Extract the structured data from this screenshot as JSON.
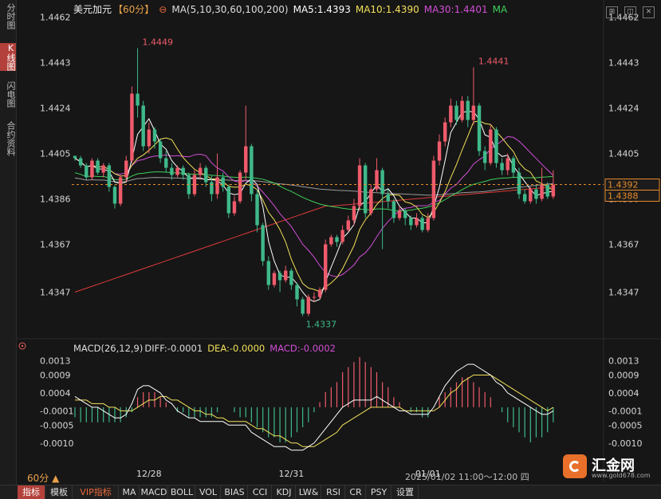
{
  "sidebar": {
    "tabs": [
      {
        "label": "分时图",
        "active": false
      },
      {
        "label": "K线图",
        "active": true
      },
      {
        "label": "闪电图",
        "active": false
      },
      {
        "label": "合约资料",
        "active": false
      }
    ]
  },
  "header": {
    "symbol": "美元加元",
    "period": "【60分】",
    "ma_params": "MA(5,10,30,60,100,200)",
    "ma5": "MA5:1.4393",
    "ma10": "MA10:1.4390",
    "ma30": "MA30:1.4401",
    "ma": "MA"
  },
  "macd_header": {
    "title": "MACD(26,12,9)",
    "diff": "DIFF:-0.0001",
    "dea": "DEA:-0.0000",
    "macd": "MACD:-0.0002"
  },
  "period_label": "60分 ▲",
  "time_range": "2025/01/02 11:00～12:00 四",
  "toolbar": [
    "指标",
    "模板",
    "VIP指标",
    "MA",
    "MACD",
    "BOLL",
    "VOL",
    "BIAS",
    "CCI",
    "KDJ",
    "LW&",
    "RSI",
    "CR",
    "PSY",
    "设置"
  ],
  "brand": {
    "name": "汇金网",
    "url": "www.gold678.com"
  },
  "colors": {
    "up": "#ef5b6b",
    "down": "#3fb98a",
    "ma5": "#ffffff",
    "ma10": "#f3e15b",
    "ma30": "#d14fd6",
    "ma60": "#3fd05a",
    "ma100": "#9a9a9a",
    "ma200": "#e03a3a",
    "dea": "#f3e15b",
    "diff": "#ffffff",
    "current": "#e88a2a"
  },
  "chart_data": [
    {
      "type": "candlestick",
      "title": "美元加元 60分",
      "ylim": [
        1.4335,
        1.4465
      ],
      "y_ticks": [
        "1.4462",
        "1.4443",
        "1.4424",
        "1.4405",
        "1.4386",
        "1.4367",
        "1.4347"
      ],
      "x_labels": [
        "12/28",
        "12/31",
        "01/01"
      ],
      "annotations": {
        "high_1": "1.4449",
        "high_2": "1.4441",
        "low": "1.4337",
        "last_price": "1.4392",
        "marker_price": "1.4388"
      },
      "candles": [
        [
          1.4404,
          1.4403,
          1.4404,
          1.4402
        ],
        [
          1.4403,
          1.44,
          1.4404,
          1.4399
        ],
        [
          1.44,
          1.4395,
          1.4401,
          1.4394
        ],
        [
          1.4395,
          1.4402,
          1.4403,
          1.4394
        ],
        [
          1.4402,
          1.4397,
          1.4403,
          1.4396
        ],
        [
          1.4397,
          1.44,
          1.4401,
          1.4395
        ],
        [
          1.44,
          1.4391,
          1.4401,
          1.4389
        ],
        [
          1.4391,
          1.4384,
          1.4392,
          1.4382
        ],
        [
          1.4384,
          1.4395,
          1.4396,
          1.4383
        ],
        [
          1.4395,
          1.4402,
          1.4404,
          1.4393
        ],
        [
          1.4402,
          1.443,
          1.4433,
          1.4401
        ],
        [
          1.443,
          1.4425,
          1.4449,
          1.442
        ],
        [
          1.4425,
          1.4408,
          1.4427,
          1.4406
        ],
        [
          1.4408,
          1.4415,
          1.4418,
          1.4405
        ],
        [
          1.4415,
          1.441,
          1.4416,
          1.4407
        ],
        [
          1.441,
          1.4403,
          1.4411,
          1.4401
        ],
        [
          1.4403,
          1.4399,
          1.4406,
          1.4397
        ],
        [
          1.4399,
          1.4396,
          1.4401,
          1.4394
        ],
        [
          1.4396,
          1.4399,
          1.44,
          1.4395
        ],
        [
          1.4399,
          1.4396,
          1.44,
          1.4394
        ],
        [
          1.4396,
          1.4388,
          1.4397,
          1.4386
        ],
        [
          1.4388,
          1.4396,
          1.4398,
          1.4387
        ],
        [
          1.4396,
          1.4399,
          1.4401,
          1.4394
        ],
        [
          1.4399,
          1.4393,
          1.44,
          1.4391
        ],
        [
          1.4393,
          1.4388,
          1.4396,
          1.4385
        ],
        [
          1.4388,
          1.4395,
          1.4405,
          1.4386
        ],
        [
          1.4395,
          1.4391,
          1.4397,
          1.4389
        ],
        [
          1.4391,
          1.438,
          1.4392,
          1.4378
        ],
        [
          1.438,
          1.4385,
          1.4387,
          1.4379
        ],
        [
          1.4385,
          1.4397,
          1.4398,
          1.4384
        ],
        [
          1.4397,
          1.4408,
          1.4425,
          1.4394
        ],
        [
          1.4408,
          1.4388,
          1.4409,
          1.4385
        ],
        [
          1.4388,
          1.4375,
          1.439,
          1.4372
        ],
        [
          1.4375,
          1.436,
          1.4376,
          1.4358
        ],
        [
          1.436,
          1.435,
          1.4362,
          1.4348
        ],
        [
          1.435,
          1.4355,
          1.4356,
          1.4349
        ],
        [
          1.4355,
          1.4352,
          1.4356,
          1.4347
        ],
        [
          1.4352,
          1.4356,
          1.4358,
          1.4351
        ],
        [
          1.4356,
          1.435,
          1.4357,
          1.4348
        ],
        [
          1.435,
          1.4344,
          1.4351,
          1.4341
        ],
        [
          1.4344,
          1.4338,
          1.4345,
          1.4337
        ],
        [
          1.4338,
          1.4345,
          1.4346,
          1.4337
        ],
        [
          1.4345,
          1.4345,
          1.4347,
          1.4343
        ],
        [
          1.4345,
          1.4348,
          1.4349,
          1.4344
        ],
        [
          1.4348,
          1.4367,
          1.4369,
          1.4347
        ],
        [
          1.4367,
          1.437,
          1.4371,
          1.4366
        ],
        [
          1.437,
          1.4368,
          1.4371,
          1.4366
        ],
        [
          1.4368,
          1.4373,
          1.4375,
          1.4367
        ],
        [
          1.4373,
          1.4377,
          1.4379,
          1.4372
        ],
        [
          1.4377,
          1.4383,
          1.4386,
          1.4375
        ],
        [
          1.4383,
          1.44,
          1.4403,
          1.4381
        ],
        [
          1.44,
          1.438,
          1.4401,
          1.4378
        ],
        [
          1.438,
          1.439,
          1.4392,
          1.4379
        ],
        [
          1.439,
          1.4398,
          1.4403,
          1.4389
        ],
        [
          1.4398,
          1.4388,
          1.4399,
          1.4365
        ],
        [
          1.4388,
          1.4385,
          1.439,
          1.4382
        ],
        [
          1.4385,
          1.4378,
          1.4386,
          1.4376
        ],
        [
          1.4378,
          1.4381,
          1.4383,
          1.4377
        ],
        [
          1.4381,
          1.4378,
          1.4382,
          1.4375
        ],
        [
          1.4378,
          1.4375,
          1.4379,
          1.4373
        ],
        [
          1.4375,
          1.4378,
          1.438,
          1.4374
        ],
        [
          1.4378,
          1.4373,
          1.4379,
          1.4372
        ],
        [
          1.4373,
          1.4378,
          1.438,
          1.4372
        ],
        [
          1.4378,
          1.4402,
          1.4404,
          1.4377
        ],
        [
          1.4402,
          1.441,
          1.4413,
          1.44
        ],
        [
          1.441,
          1.4418,
          1.442,
          1.4408
        ],
        [
          1.4418,
          1.4425,
          1.4428,
          1.4416
        ],
        [
          1.4425,
          1.4419,
          1.4427,
          1.4417
        ],
        [
          1.4419,
          1.4427,
          1.4429,
          1.4418
        ],
        [
          1.4427,
          1.4419,
          1.4429,
          1.4416
        ],
        [
          1.4419,
          1.4425,
          1.4441,
          1.4417
        ],
        [
          1.4425,
          1.4406,
          1.4426,
          1.4404
        ],
        [
          1.4406,
          1.4401,
          1.4408,
          1.4398
        ],
        [
          1.4401,
          1.4415,
          1.4417,
          1.44
        ],
        [
          1.4415,
          1.4401,
          1.4416,
          1.4399
        ],
        [
          1.4401,
          1.4398,
          1.4403,
          1.4396
        ],
        [
          1.4398,
          1.4403,
          1.4405,
          1.4396
        ],
        [
          1.4403,
          1.4397,
          1.4404,
          1.4395
        ],
        [
          1.4397,
          1.4388,
          1.4399,
          1.4386
        ],
        [
          1.4388,
          1.4385,
          1.439,
          1.4384
        ],
        [
          1.4385,
          1.439,
          1.4391,
          1.4384
        ],
        [
          1.439,
          1.4386,
          1.4392,
          1.4384
        ],
        [
          1.4386,
          1.4392,
          1.4399,
          1.4385
        ],
        [
          1.4392,
          1.4387,
          1.4393,
          1.4386
        ],
        [
          1.4387,
          1.4392,
          1.4398,
          1.4386
        ]
      ]
    },
    {
      "type": "line",
      "title": "MACD(26,12,9)",
      "ylim": [
        -0.0014,
        0.0014
      ],
      "y_ticks": [
        "0.0013",
        "0.0009",
        "0.0004",
        "-0.0001",
        "-0.0005",
        "-0.0010"
      ],
      "macd_hist": [
        -0.0002,
        -0.0003,
        -0.0003,
        -0.0003,
        -0.0003,
        -0.0003,
        -0.0003,
        -0.0003,
        -0.0003,
        -0.0002,
        -0.0001,
        0.0002,
        0.0003,
        0.0003,
        0.0003,
        0.0002,
        0.0001,
        0.0,
        -0.0001,
        -0.0001,
        -0.0002,
        -0.0002,
        -0.0002,
        -0.0002,
        -0.0002,
        -0.0001,
        0.0,
        0.0,
        -0.0001,
        -0.0002,
        -0.0002,
        -0.0003,
        -0.0004,
        -0.0005,
        -0.0006,
        -0.0006,
        -0.0007,
        -0.0007,
        -0.0006,
        -0.0005,
        -0.0004,
        -0.0003,
        -0.0001,
        0.0001,
        0.0003,
        0.0004,
        0.0005,
        0.0007,
        0.0008,
        0.0009,
        0.001,
        0.0009,
        0.0008,
        0.0007,
        0.0005,
        0.0004,
        0.0002,
        0.0001,
        0.0,
        -0.0001,
        -0.0001,
        -0.0002,
        -0.0002,
        0.0,
        0.0002,
        0.0003,
        0.0004,
        0.0005,
        0.0006,
        0.0006,
        0.0005,
        0.0004,
        0.0003,
        0.0002,
        0.0,
        -0.0001,
        -0.0003,
        -0.0004,
        -0.0005,
        -0.0006,
        -0.0007,
        -0.0006,
        -0.0006,
        -0.0005,
        -0.0003
      ],
      "diff": [
        0.0003,
        0.0002,
        0.0001,
        0.0,
        0.0,
        -0.0001,
        -0.0002,
        -0.0003,
        -0.0003,
        -0.0002,
        0.0001,
        0.0005,
        0.0006,
        0.0006,
        0.0005,
        0.0004,
        0.0002,
        0.0001,
        -0.0001,
        -0.0002,
        -0.0003,
        -0.0003,
        -0.0004,
        -0.0004,
        -0.0004,
        -0.0004,
        -0.0004,
        -0.0005,
        -0.0005,
        -0.0005,
        -0.0005,
        -0.0007,
        -0.0008,
        -0.0009,
        -0.001,
        -0.0011,
        -0.0011,
        -0.0011,
        -0.0012,
        -0.0012,
        -0.0012,
        -0.0011,
        -0.001,
        -0.0008,
        -0.0006,
        -0.0004,
        -0.0002,
        0.0,
        0.0001,
        0.0002,
        0.0002,
        0.0002,
        0.0002,
        0.0003,
        0.0002,
        0.0001,
        0.0,
        -0.0001,
        -0.0001,
        -0.0002,
        -0.0002,
        -0.0002,
        -0.0002,
        0.0,
        0.0003,
        0.0006,
        0.0008,
        0.001,
        0.0011,
        0.0012,
        0.0012,
        0.0011,
        0.001,
        0.0009,
        0.0007,
        0.0006,
        0.0004,
        0.0003,
        0.0002,
        0.0001,
        0.0,
        -0.0001,
        -0.0002,
        -0.0002,
        -0.0001
      ],
      "dea": [
        0.0002,
        0.0002,
        0.0002,
        0.0001,
        0.0001,
        0.0001,
        0.0,
        0.0,
        -0.0001,
        -0.0001,
        -0.0001,
        0.0,
        0.0001,
        0.0002,
        0.0002,
        0.0003,
        0.0003,
        0.0002,
        0.0002,
        0.0001,
        0.0,
        -0.0001,
        -0.0001,
        -0.0002,
        -0.0002,
        -0.0003,
        -0.0003,
        -0.0004,
        -0.0004,
        -0.0004,
        -0.0004,
        -0.0005,
        -0.0006,
        -0.0006,
        -0.0007,
        -0.0008,
        -0.0008,
        -0.0009,
        -0.001,
        -0.001,
        -0.0011,
        -0.0011,
        -0.0011,
        -0.001,
        -0.0009,
        -0.0008,
        -0.0007,
        -0.0005,
        -0.0004,
        -0.0003,
        -0.0002,
        -0.0001,
        0.0,
        0.0,
        0.0,
        0.0,
        0.0,
        0.0,
        -0.0001,
        -0.0001,
        -0.0001,
        -0.0001,
        -0.0001,
        -0.0001,
        0.0,
        0.0002,
        0.0004,
        0.0005,
        0.0007,
        0.0008,
        0.0009,
        0.0009,
        0.0009,
        0.0009,
        0.0008,
        0.0007,
        0.0006,
        0.0005,
        0.0004,
        0.0003,
        0.0002,
        0.0001,
        0.0,
        -0.0001,
        -0.0
      ]
    }
  ]
}
